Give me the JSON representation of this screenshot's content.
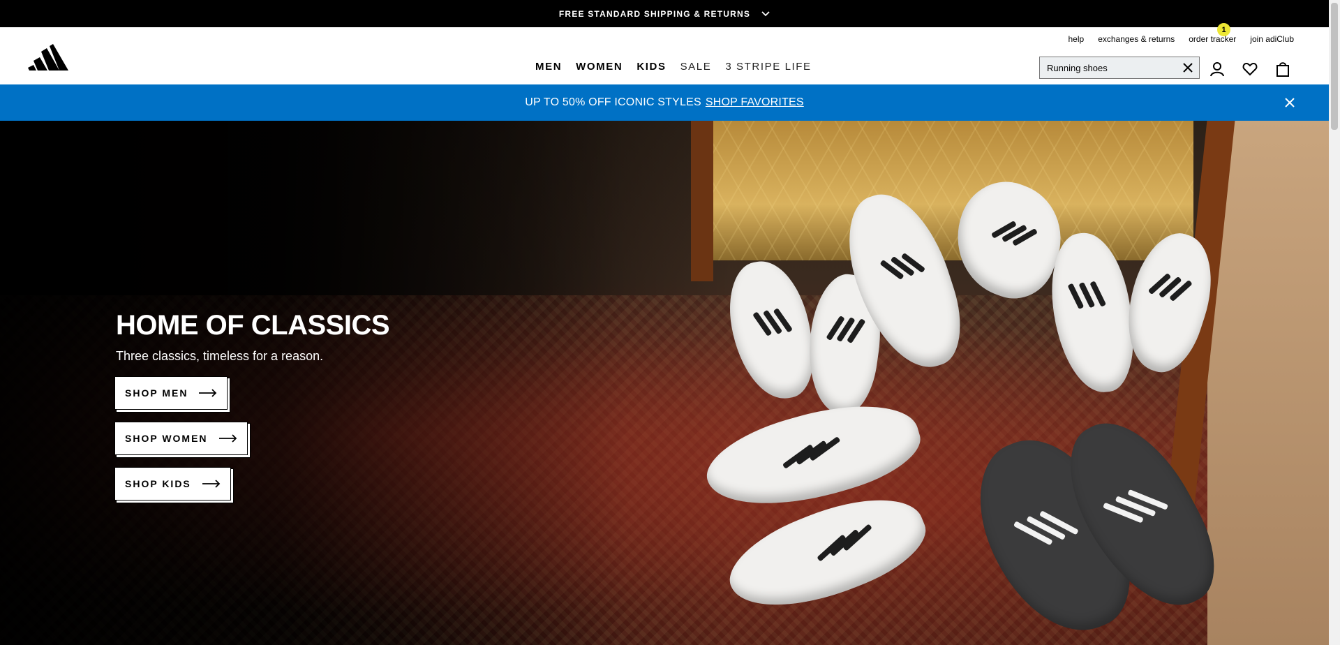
{
  "topbar": {
    "message": "FREE STANDARD SHIPPING & RETURNS",
    "icon": "chevron-down-icon"
  },
  "header": {
    "logo": "adidas-logo",
    "util_links": [
      "help",
      "exchanges & returns",
      "order tracker",
      "join adiClub"
    ],
    "nav": [
      {
        "label": "MEN",
        "weight": "bold"
      },
      {
        "label": "WOMEN",
        "weight": "bold"
      },
      {
        "label": "KIDS",
        "weight": "bold"
      },
      {
        "label": "SALE",
        "weight": "light"
      },
      {
        "label": "3 STRIPE LIFE",
        "weight": "light"
      }
    ],
    "search": {
      "value": "Running shoes",
      "placeholder": ""
    },
    "account_badge": "1"
  },
  "promo": {
    "text": "UP TO 50% OFF ICONIC STYLES",
    "link": "SHOP FAVORITES",
    "color": "#0071c5"
  },
  "hero": {
    "title": "HOME OF CLASSICS",
    "subtitle": "Three classics, timeless for a reason.",
    "buttons": [
      "SHOP MEN",
      "SHOP WOMEN",
      "SHOP KIDS"
    ]
  },
  "colors": {
    "topbar": "#000000",
    "promo": "#0071c5",
    "badge": "#ede734"
  }
}
